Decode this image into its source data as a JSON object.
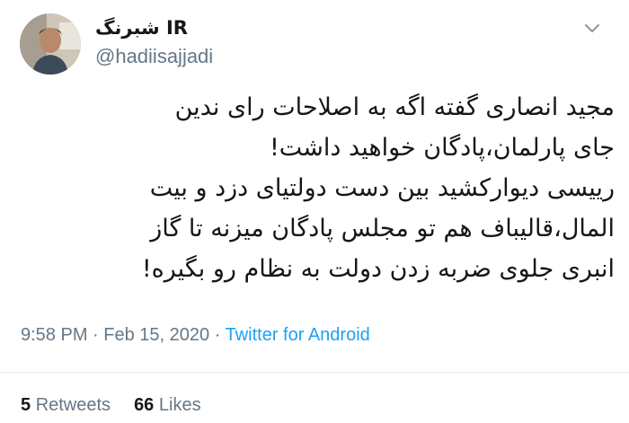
{
  "tweet": {
    "author": {
      "display_name": "شبرنگ IR",
      "handle": "@hadiisajjadi"
    },
    "text_lines": [
      "مجید انصاری گفته اگه به اصلاحات رای ندین",
      "جای پارلمان،پادگان خواهید داشت!",
      "رییسی دیوارکشید بین دست دولتیای دزد و بیت",
      "المال،قالیباف هم تو مجلس پادگان میزنه تا گاز",
      "انبری جلوی ضربه زدن دولت به نظام رو بگیره!"
    ],
    "time": "9:58 PM",
    "separator": "·",
    "date": "Feb 15, 2020",
    "source": "Twitter for Android",
    "retweets_count": "5",
    "retweets_label": "Retweets",
    "likes_count": "66",
    "likes_label": "Likes"
  },
  "icons": {
    "avatar": "profile-photo",
    "menu": "chevron-down-icon"
  },
  "colors": {
    "text": "#14171a",
    "secondary": "#657786",
    "link": "#1da1f2",
    "divider": "#e6ecf0"
  }
}
